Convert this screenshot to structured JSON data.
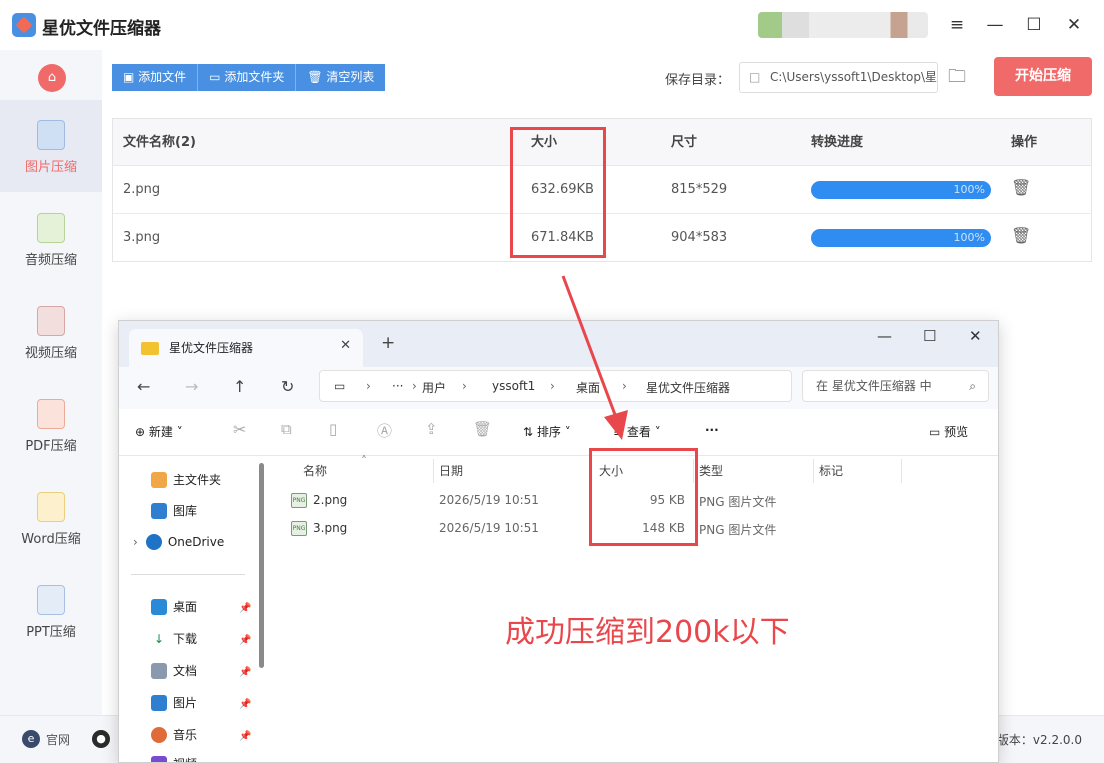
{
  "app": {
    "title": "星优文件压缩器",
    "window_controls": [
      "≡",
      "—",
      "☐",
      "✕"
    ]
  },
  "sidebar": {
    "home_icon": "home-icon",
    "items": [
      {
        "label": "图片压缩",
        "active": true,
        "icon": "image-icon"
      },
      {
        "label": "音频压缩",
        "active": false,
        "icon": "audio-icon"
      },
      {
        "label": "视频压缩",
        "active": false,
        "icon": "video-icon"
      },
      {
        "label": "PDF压缩",
        "active": false,
        "icon": "pdf-icon"
      },
      {
        "label": "Word压缩",
        "active": false,
        "icon": "word-icon"
      },
      {
        "label": "PPT压缩",
        "active": false,
        "icon": "ppt-icon"
      }
    ]
  },
  "toolbar": {
    "add_file": "添加文件",
    "add_folder": "添加文件夹",
    "clear_list": "清空列表",
    "save_dir_label": "保存目录：",
    "save_dir_value": "C:\\Users\\yssoft1\\Desktop\\星",
    "start_button": "开始压缩"
  },
  "file_table": {
    "headers": [
      "文件名称(2)",
      "大小",
      "尺寸",
      "转换进度",
      "操作"
    ],
    "rows": [
      {
        "name": "2.png",
        "size": "632.69KB",
        "dimensions": "815*529",
        "progress": "100%"
      },
      {
        "name": "3.png",
        "size": "671.84KB",
        "dimensions": "904*583",
        "progress": "100%"
      }
    ]
  },
  "status": {
    "website": "官网",
    "version": "版本：v2.2.0.0"
  },
  "explorer": {
    "tab_title": "星优文件压缩器",
    "new_tab": "+",
    "controls": [
      "—",
      "☐",
      "✕"
    ],
    "breadcrumb": [
      "用户",
      "yssoft1",
      "桌面",
      "星优文件压缩器"
    ],
    "breadcrumb_more": "···",
    "search_placeholder": "在 星优文件压缩器 中",
    "commands": {
      "new": "新建",
      "sort": "排序",
      "view": "查看",
      "more": "···",
      "preview": "预览"
    },
    "nav_items": [
      {
        "label": "主文件夹",
        "icon": "home-folder-icon"
      },
      {
        "label": "图库",
        "icon": "gallery-icon"
      },
      {
        "label": "OneDrive",
        "icon": "onedrive-icon"
      },
      {
        "label": "桌面",
        "icon": "desktop-icon"
      },
      {
        "label": "下载",
        "icon": "download-icon"
      },
      {
        "label": "文档",
        "icon": "document-icon"
      },
      {
        "label": "图片",
        "icon": "pictures-icon"
      },
      {
        "label": "音乐",
        "icon": "music-icon"
      },
      {
        "label": "视频",
        "icon": "videos-icon"
      }
    ],
    "columns": [
      "名称",
      "日期",
      "大小",
      "类型",
      "标记"
    ],
    "files": [
      {
        "name": "2.png",
        "date": "2026/5/19 10:51",
        "size": "95 KB",
        "type": "PNG 图片文件"
      },
      {
        "name": "3.png",
        "date": "2026/5/19 10:51",
        "size": "148 KB",
        "type": "PNG 图片文件"
      }
    ]
  },
  "annotation": {
    "text": "成功压缩到200k以下",
    "color": "#e8474b"
  },
  "colors": {
    "accent_blue": "#4a90e2",
    "accent_red": "#f06a6a",
    "progress_blue": "#2f8cf0"
  }
}
